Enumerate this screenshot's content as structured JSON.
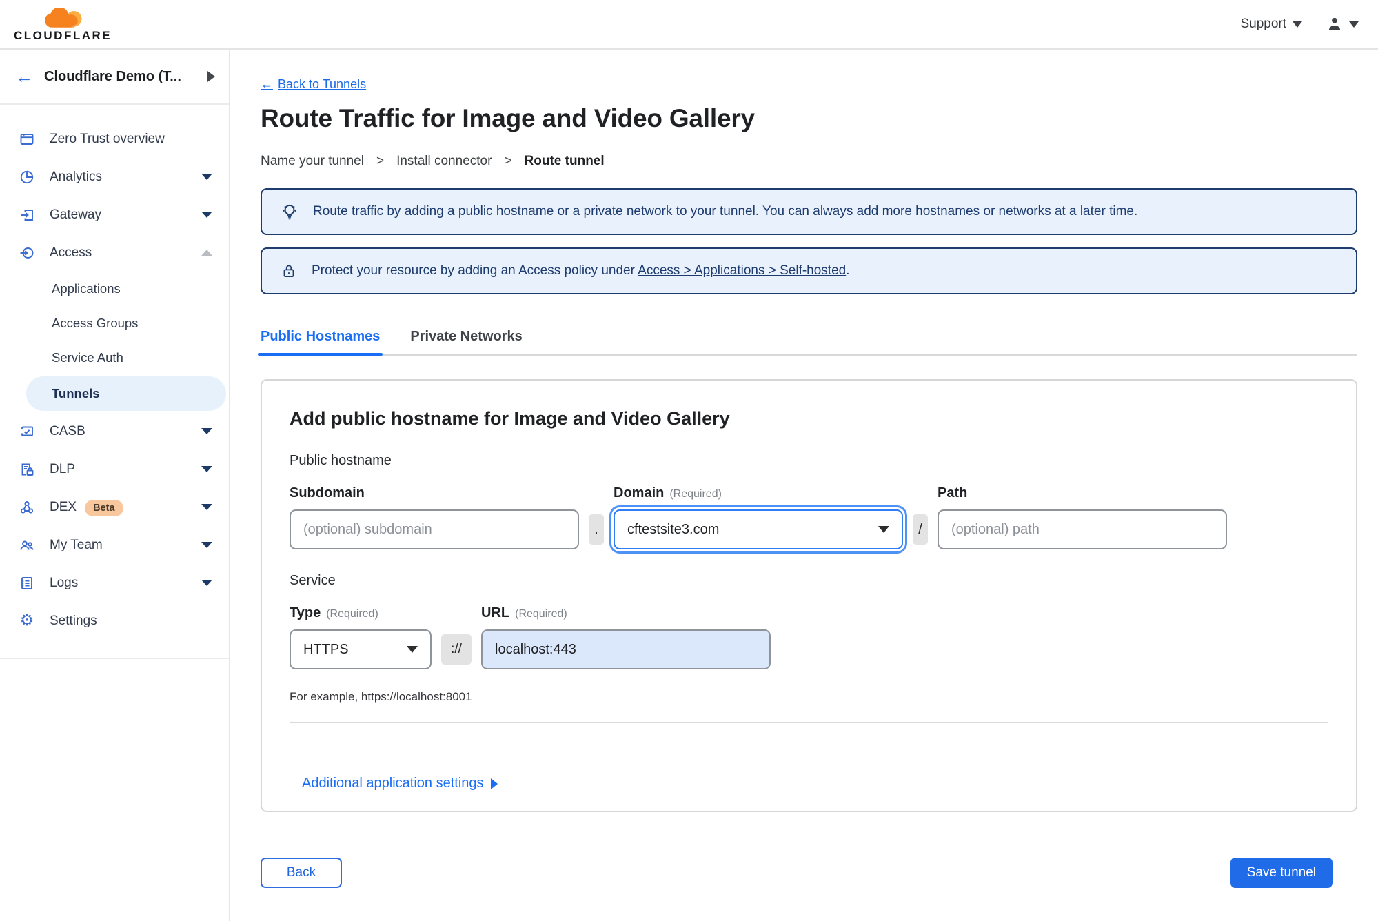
{
  "brand": {
    "name": "CLOUDFLARE"
  },
  "header": {
    "support_label": "Support"
  },
  "icons": {
    "back_arrow": "←"
  },
  "sidebar": {
    "account_name": "Cloudflare Demo (T...",
    "items": [
      {
        "label": "Zero Trust overview"
      },
      {
        "label": "Analytics"
      },
      {
        "label": "Gateway"
      },
      {
        "label": "Access"
      },
      {
        "label": "CASB"
      },
      {
        "label": "DLP"
      },
      {
        "label": "DEX",
        "badge": "Beta"
      },
      {
        "label": "My Team"
      },
      {
        "label": "Logs"
      },
      {
        "label": "Settings"
      }
    ],
    "access_children": [
      {
        "label": "Applications"
      },
      {
        "label": "Access Groups"
      },
      {
        "label": "Service Auth"
      },
      {
        "label": "Tunnels"
      }
    ]
  },
  "page": {
    "back_label": "Back to Tunnels",
    "title": "Route Traffic for Image and Video Gallery",
    "steps": [
      "Name your tunnel",
      "Install connector",
      "Route tunnel"
    ],
    "step_separator": ">",
    "banner_tip": "Route traffic by adding a public hostname or a private network to your tunnel. You can always add more hostnames or networks at a later time.",
    "banner_lock_before": "Protect your resource by adding an Access policy under ",
    "banner_lock_link": "Access > Applications > Self-hosted",
    "banner_lock_after": ".",
    "tabs": [
      {
        "label": "Public Hostnames"
      },
      {
        "label": "Private Networks"
      }
    ]
  },
  "form": {
    "card_title": "Add public hostname for Image and Video Gallery",
    "hostname_section": "Public hostname",
    "subdomain": {
      "label": "Subdomain",
      "placeholder": "(optional) subdomain"
    },
    "domain": {
      "label": "Domain",
      "required": "(Required)",
      "value": "cftestsite3.com"
    },
    "path": {
      "label": "Path",
      "placeholder": "(optional) path"
    },
    "dot_separator": ".",
    "slash_separator": "/",
    "service_section": "Service",
    "type": {
      "label": "Type",
      "required": "(Required)",
      "value": "HTTPS"
    },
    "scheme_separator": "://",
    "url": {
      "label": "URL",
      "required": "(Required)",
      "value": "localhost:443"
    },
    "example": "For example, https://localhost:8001",
    "additional_settings_label": "Additional application settings"
  },
  "footer": {
    "back_label": "Back",
    "save_label": "Save tunnel"
  },
  "colors": {
    "accent": "#1a6ef5",
    "banner_border": "#1e3c6e",
    "banner_bg": "#e9f2fc",
    "badge_bg": "#f8c79e",
    "save_button": "#1f6be8"
  }
}
